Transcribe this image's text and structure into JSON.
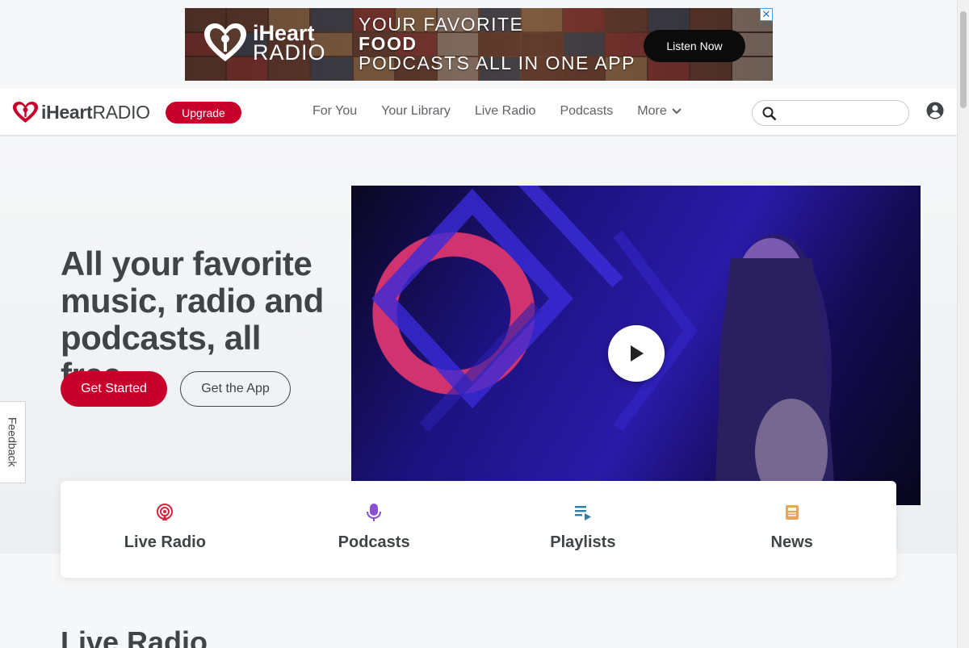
{
  "ad": {
    "brand_line1": "iHeart",
    "brand_line2": "RADIO",
    "headline_1": "YOUR FAVORITE",
    "headline_2": "FOOD",
    "headline_3": "PODCASTS ALL IN ONE APP",
    "cta": "Listen Now",
    "close": "✕"
  },
  "header": {
    "logo_strong": "iHeart",
    "logo_light": "RADIO",
    "upgrade_label": "Upgrade",
    "nav": [
      "For You",
      "Your Library",
      "Live Radio",
      "Podcasts",
      "More"
    ],
    "search_placeholder": ""
  },
  "hero": {
    "title": "All your favorite music, radio and podcasts, all free.",
    "get_started": "Get Started",
    "get_app": "Get the App"
  },
  "quick_links": [
    {
      "label": "Live Radio",
      "icon": "radio-tower-icon",
      "color": "#d6243f"
    },
    {
      "label": "Podcasts",
      "icon": "microphone-icon",
      "color": "#8a4fd3"
    },
    {
      "label": "Playlists",
      "icon": "playlist-icon",
      "color": "#2f7ea0"
    },
    {
      "label": "News",
      "icon": "newspaper-icon",
      "color": "#e7a45c"
    }
  ],
  "feedback": "Feedback",
  "section": {
    "title": "Live Radio"
  },
  "colors": {
    "brand_red": "#c6002b",
    "text_dark": "#3f4447"
  }
}
